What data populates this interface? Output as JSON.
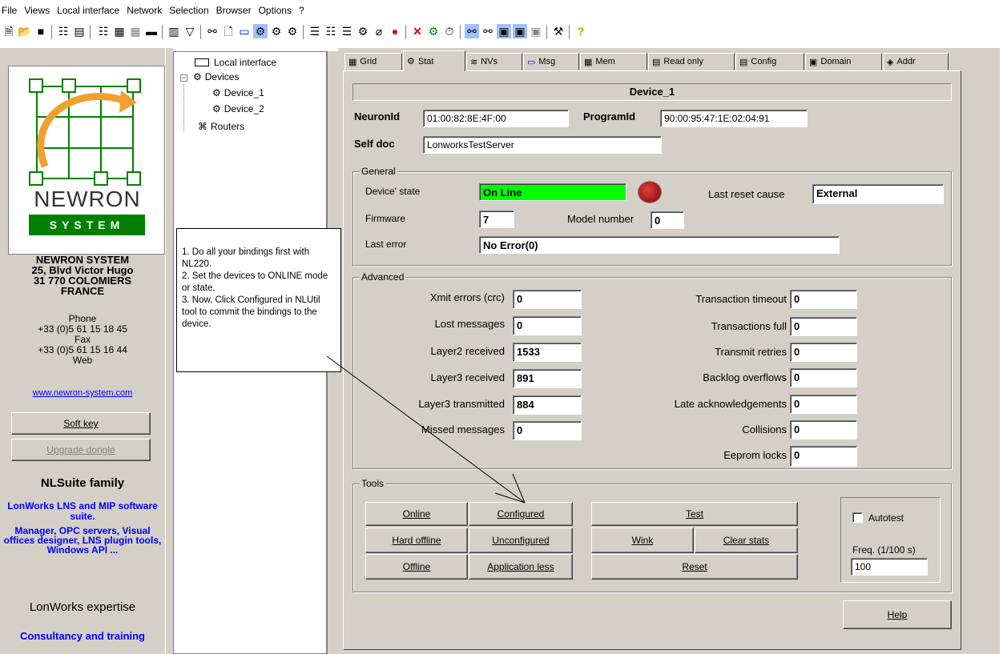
{
  "menu": [
    "File",
    "Views",
    "Local interface",
    "Network",
    "Selection",
    "Browser",
    "Options",
    "?"
  ],
  "sidebar": {
    "logo_brand": "NEWRON",
    "logo_system": "SYSTEM",
    "company": "NEWRON SYSTEM",
    "address1": "25, Blvd Victor Hugo",
    "address2": "31 770 COLOMIERS",
    "country": "FRANCE",
    "phone_label": "Phone",
    "phone": "+33 (0)5 61 15 18 45",
    "fax_label": "Fax",
    "fax": "+33 (0)5 61 15 16 44",
    "web_label": "Web",
    "web_link": "www.newron-system.com",
    "soft_key": "Soft key",
    "upgrade_dongle": "Upgrade dongle",
    "family_title": "NLSuite family",
    "blurb1": "LonWorks LNS and MIP software suite.",
    "blurb2": "Manager, OPC servers, Visual offices designer, LNS plugin tools, Windows API ...",
    "expertise": "LonWorks expertise",
    "consultancy": "Consultancy and training"
  },
  "tree": {
    "local_interface": "Local interface",
    "devices": "Devices",
    "device1": "Device_1",
    "device2": "Device_2",
    "routers": "Routers"
  },
  "note": "1. Do all your bindings first with NL220.\n2. Set the devices to ONLINE mode or state.\n3. Now, Click Configured in NLUtil tool to commit the bindings to the device.",
  "tabs": [
    {
      "icon": "grid-icon",
      "label": "Grid"
    },
    {
      "icon": "stat-icon",
      "label": "Stat"
    },
    {
      "icon": "nvs-icon",
      "label": "NVs"
    },
    {
      "icon": "msg-icon",
      "label": "Msg"
    },
    {
      "icon": "mem-icon",
      "label": "Mem"
    },
    {
      "icon": "readonly-icon",
      "label": "Read only"
    },
    {
      "icon": "config-icon",
      "label": "Config"
    },
    {
      "icon": "domain-icon",
      "label": "Domain"
    },
    {
      "icon": "addr-icon",
      "label": "Addr"
    }
  ],
  "device": {
    "title": "Device_1",
    "neuron_id_label": "NeuronId",
    "neuron_id": "01:00:82:8E:4F:00",
    "program_id_label": "ProgramId",
    "program_id": "90:00:95:47:1E:02:04:91",
    "self_doc_label": "Self doc",
    "self_doc": "LonworksTestServer"
  },
  "general": {
    "title": "General",
    "state_label": "Device' state",
    "state": "On Line",
    "state_color": "#00ff00",
    "reset_label": "Last reset cause",
    "reset": "External",
    "firmware_label": "Firmware",
    "firmware": "7",
    "model_label": "Model number",
    "model": "0",
    "error_label": "Last error",
    "error": "No Error(0)"
  },
  "advanced": {
    "title": "Advanced",
    "left": [
      {
        "label": "Xmit errors (crc)",
        "value": "0"
      },
      {
        "label": "Lost messages",
        "value": "0"
      },
      {
        "label": "Layer2 received",
        "value": "1533"
      },
      {
        "label": "Layer3 received",
        "value": "891"
      },
      {
        "label": "Layer3 transmitted",
        "value": "884"
      },
      {
        "label": "Missed messages",
        "value": "0"
      }
    ],
    "right": [
      {
        "label": "Transaction timeout",
        "value": "0"
      },
      {
        "label": "Transactions full",
        "value": "0"
      },
      {
        "label": "Transmit retries",
        "value": "0"
      },
      {
        "label": "Backlog overflows",
        "value": "0"
      },
      {
        "label": "Late acknowledgements",
        "value": "0"
      },
      {
        "label": "Collisions",
        "value": "0"
      },
      {
        "label": "Eeprom locks",
        "value": "0"
      }
    ]
  },
  "tools": {
    "title": "Tools",
    "online": "Online",
    "configured": "Configured",
    "hard_offline": "Hard offline",
    "unconfigured": "Unconfigured",
    "offline": "Offline",
    "application_less": "Application less",
    "test": "Test",
    "wink": "Wink",
    "clear_stats": "Clear stats",
    "reset": "Reset",
    "autotest": "Autotest",
    "freq_label": "Freq. (1/100 s)",
    "freq": "100"
  },
  "help": "Help"
}
